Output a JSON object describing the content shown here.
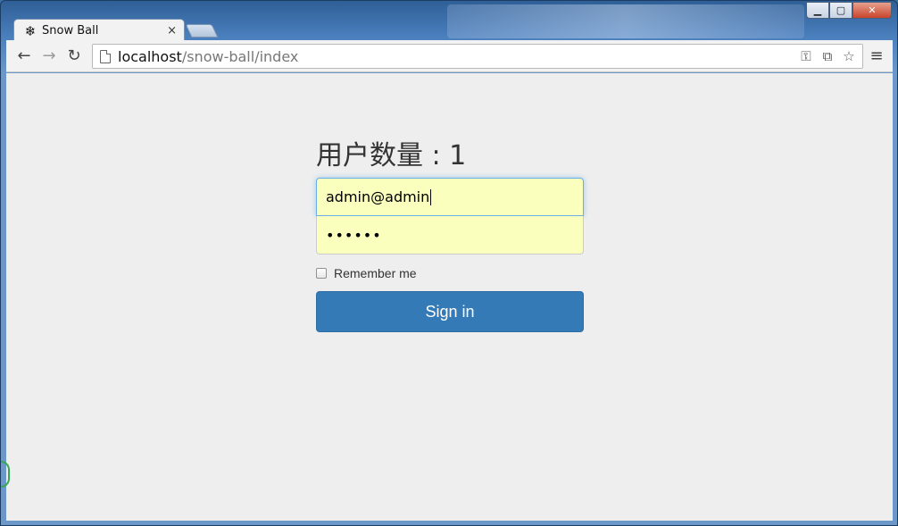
{
  "window": {
    "minimize_glyph": "▁",
    "maximize_glyph": "▢",
    "close_glyph": "✕"
  },
  "tab": {
    "favicon": "❄",
    "title": "Snow Ball",
    "close_glyph": "×"
  },
  "toolbar": {
    "back_glyph": "←",
    "forward_glyph": "→",
    "reload_glyph": "↻",
    "url_host": "localhost",
    "url_path": "/snow-ball/index",
    "key_glyph": "⚿",
    "translate_glyph": "⧉",
    "star_glyph": "☆",
    "menu_glyph": "≡"
  },
  "page": {
    "heading": "用户数量 : 1",
    "email_value": "admin@admin",
    "password_value": "••••••",
    "remember_label": "Remember me",
    "remember_checked": false,
    "signin_label": "Sign in"
  },
  "colors": {
    "primary_button": "#337ab7",
    "autofill_background": "#faffbd",
    "focus_border": "#66afe9",
    "page_background": "#eeeeee"
  }
}
